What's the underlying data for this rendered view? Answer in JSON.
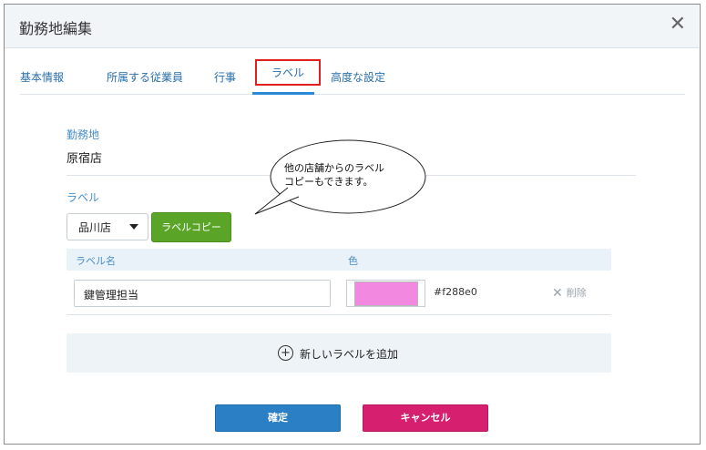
{
  "dialog": {
    "title": "勤務地編集",
    "close_glyph": "✕"
  },
  "tabs": [
    {
      "label": "基本情報"
    },
    {
      "label": "所属する従業員"
    },
    {
      "label": "行事"
    },
    {
      "label": "ラベル"
    },
    {
      "label": "高度な設定"
    }
  ],
  "workplace": {
    "label": "勤務地",
    "value": "原宿店"
  },
  "labels_section": {
    "label": "ラベル",
    "store_select": "品川店",
    "copy_button": "ラベルコピー"
  },
  "table": {
    "col_name": "ラベル名",
    "col_color": "色",
    "rows": [
      {
        "name": "鍵管理担当",
        "color": "#f288e0",
        "delete_label": "削除"
      }
    ]
  },
  "add_label": {
    "icon": "plus-circle-icon",
    "text": "新しいラベルを追加"
  },
  "footer": {
    "confirm": "確定",
    "cancel": "キャンセル"
  },
  "callout": {
    "line1": "他の店舗からのラベル",
    "line2": "コピーもできます。"
  }
}
